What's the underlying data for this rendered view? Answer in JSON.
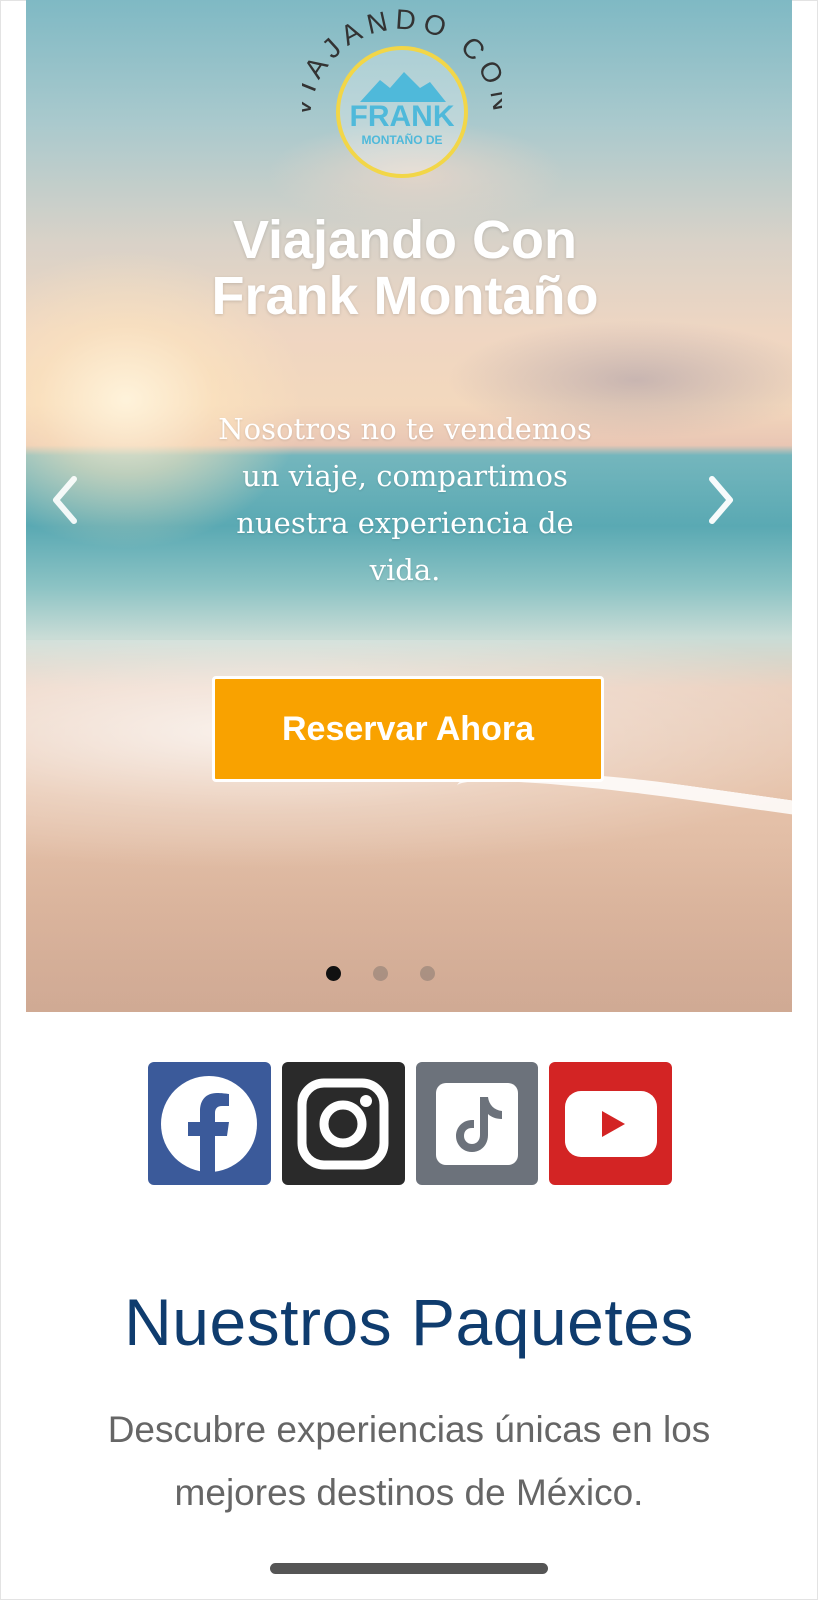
{
  "hero": {
    "logo": {
      "arc_text": "VIAJANDO CON",
      "brand": "FRANK",
      "sub": "MONTAÑO DE",
      "ring_color": "#f2d648",
      "brand_color": "#4fb9da"
    },
    "title_line1": "Viajando Con",
    "title_line2": "Frank Montaño",
    "subtitle": "Nosotros no te vendemos un viaje, compartimos nuestra experiencia de vida.",
    "cta_label": "Reservar Ahora",
    "cta_color": "#f9a200",
    "prev_icon": "chevron-left-icon",
    "next_icon": "chevron-right-icon",
    "slides": {
      "count": 3,
      "active": 1
    }
  },
  "social": [
    {
      "name": "facebook",
      "icon": "facebook-icon",
      "color": "#3b5a9a"
    },
    {
      "name": "instagram",
      "icon": "instagram-icon",
      "color": "#2a2a2a"
    },
    {
      "name": "tiktok",
      "icon": "tiktok-icon",
      "color": "#6c727b"
    },
    {
      "name": "youtube",
      "icon": "youtube-icon",
      "color": "#d32424"
    }
  ],
  "packages": {
    "title": "Nuestros Paquetes",
    "description": "Descubre experiencias únicas en los mejores destinos de México.",
    "title_color": "#0f3c6e"
  }
}
